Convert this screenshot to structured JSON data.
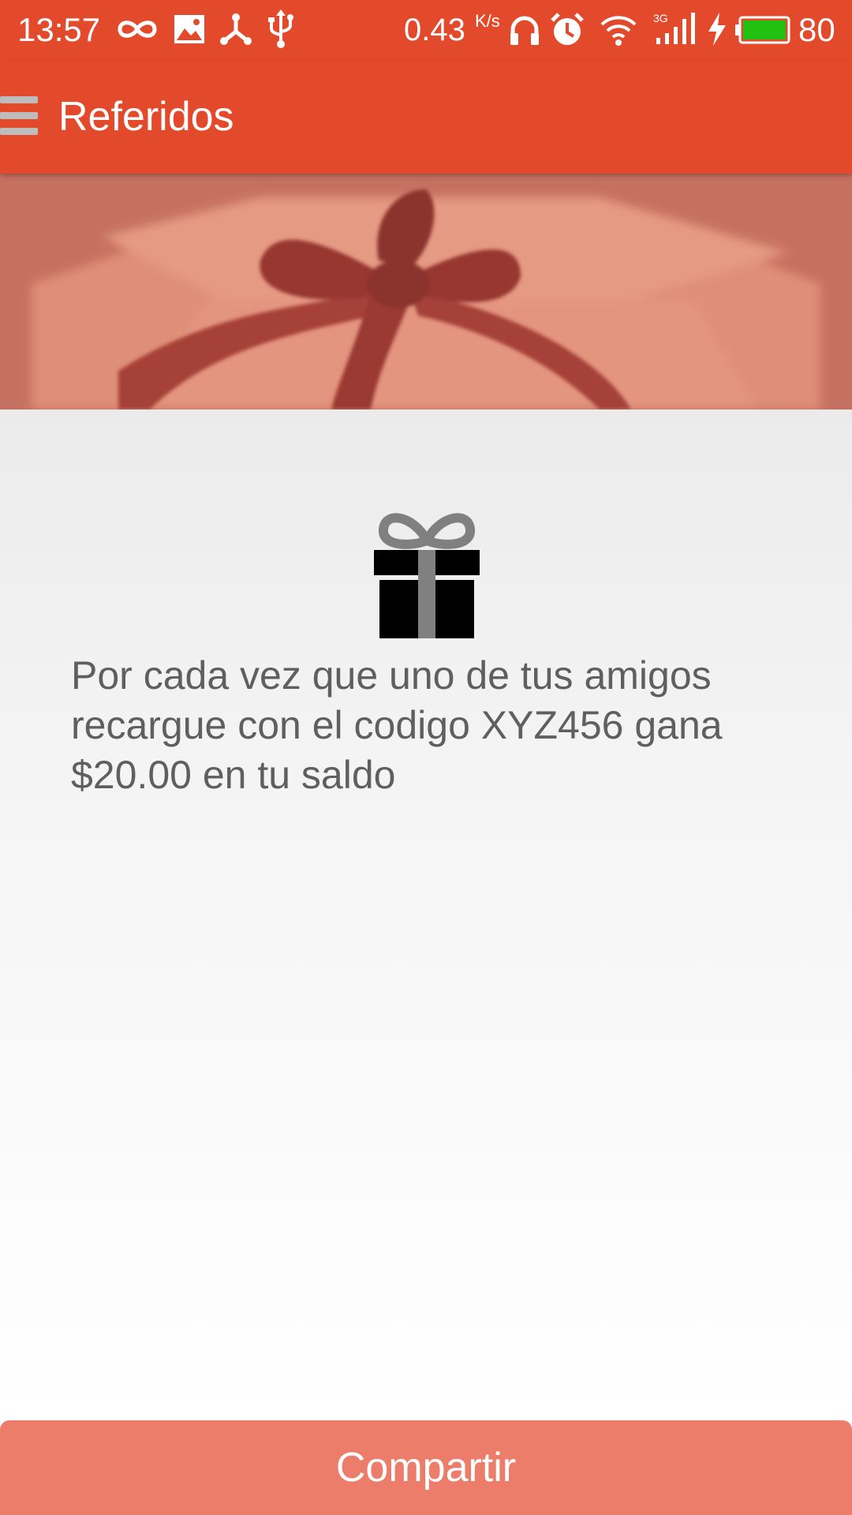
{
  "status_bar": {
    "time": "13:57",
    "network_speed": "0.43",
    "network_unit": "K/s",
    "network_type": "3G",
    "battery_percent": "80",
    "battery_color": "#22C111",
    "icons": [
      "infinity-icon",
      "image-icon",
      "share-node-icon",
      "usb-icon",
      "headphones-icon",
      "alarm-icon",
      "wifi-icon",
      "signal-icon",
      "charging-icon",
      "battery-icon"
    ]
  },
  "toolbar": {
    "title": "Referidos",
    "menu_icon": "hamburger-menu-icon"
  },
  "hero": {
    "image": "gift-box-photo"
  },
  "main": {
    "icon": "gift-icon",
    "message": "Por cada vez que uno de tus amigos recargue con el codigo XYZ456 gana $20.00 en tu saldo"
  },
  "footer": {
    "share_label": "Compartir"
  },
  "colors": {
    "primary": "#E34A2B",
    "button": "#EC7D6A",
    "text": "#5F5F5F"
  }
}
